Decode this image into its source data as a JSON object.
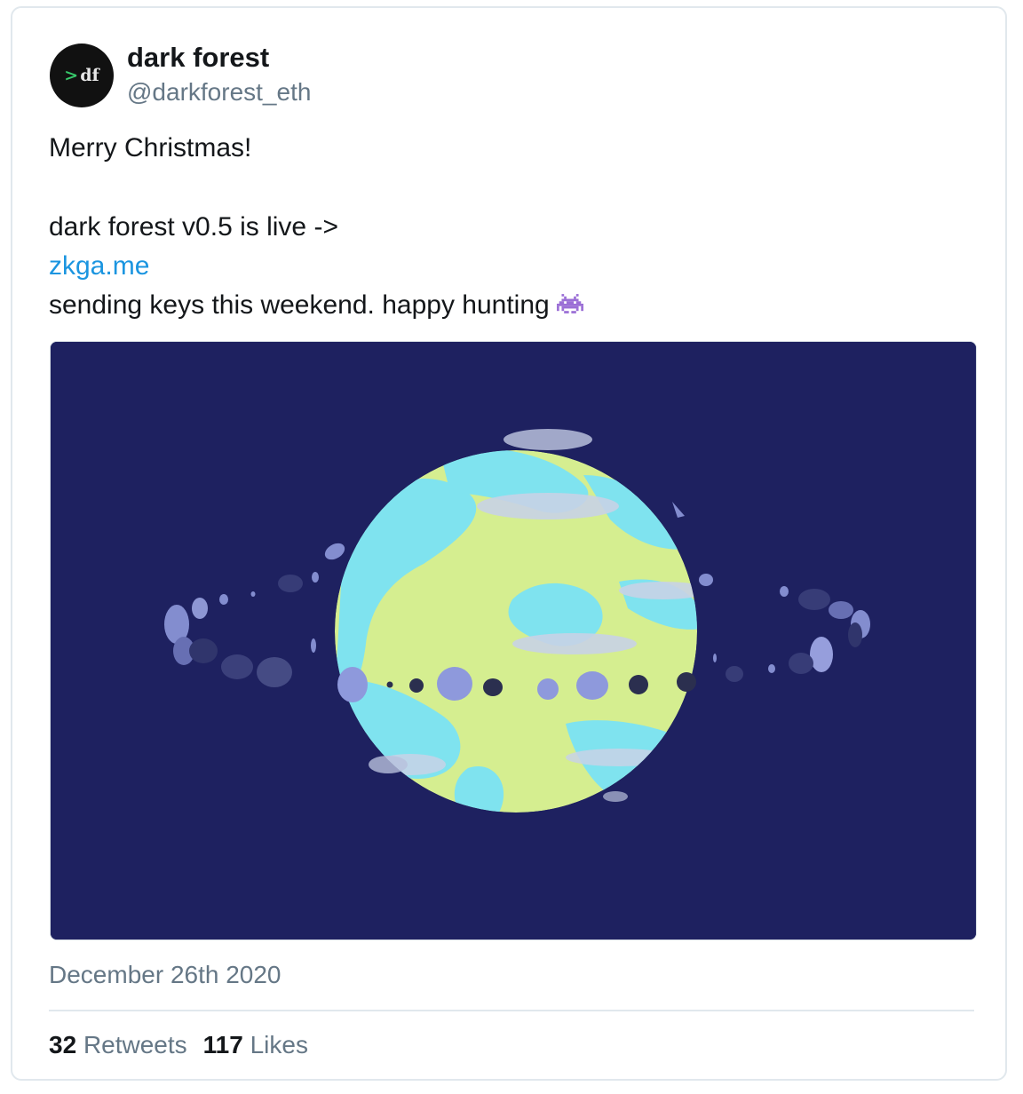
{
  "author": {
    "avatar_text": "df",
    "avatar_prefix": ">",
    "name": "dark forest",
    "handle": "@darkforest_eth"
  },
  "tweet": {
    "line1": "Merry Christmas!",
    "line2": "dark forest v0.5 is live ->",
    "link": "zkga.me",
    "line3": "sending keys this weekend. happy hunting",
    "emoji": "alien-monster-icon"
  },
  "date": "December 26th 2020",
  "stats": {
    "retweets_count": "32",
    "retweets_label": "Retweets",
    "likes_count": "117",
    "likes_label": "Likes"
  },
  "colors": {
    "link": "#1b95e0",
    "media_bg": "#1e2160",
    "planet_green": "#d5ee90",
    "planet_cyan": "#7fe3ef",
    "ring_lilac": "#8e99dc"
  }
}
